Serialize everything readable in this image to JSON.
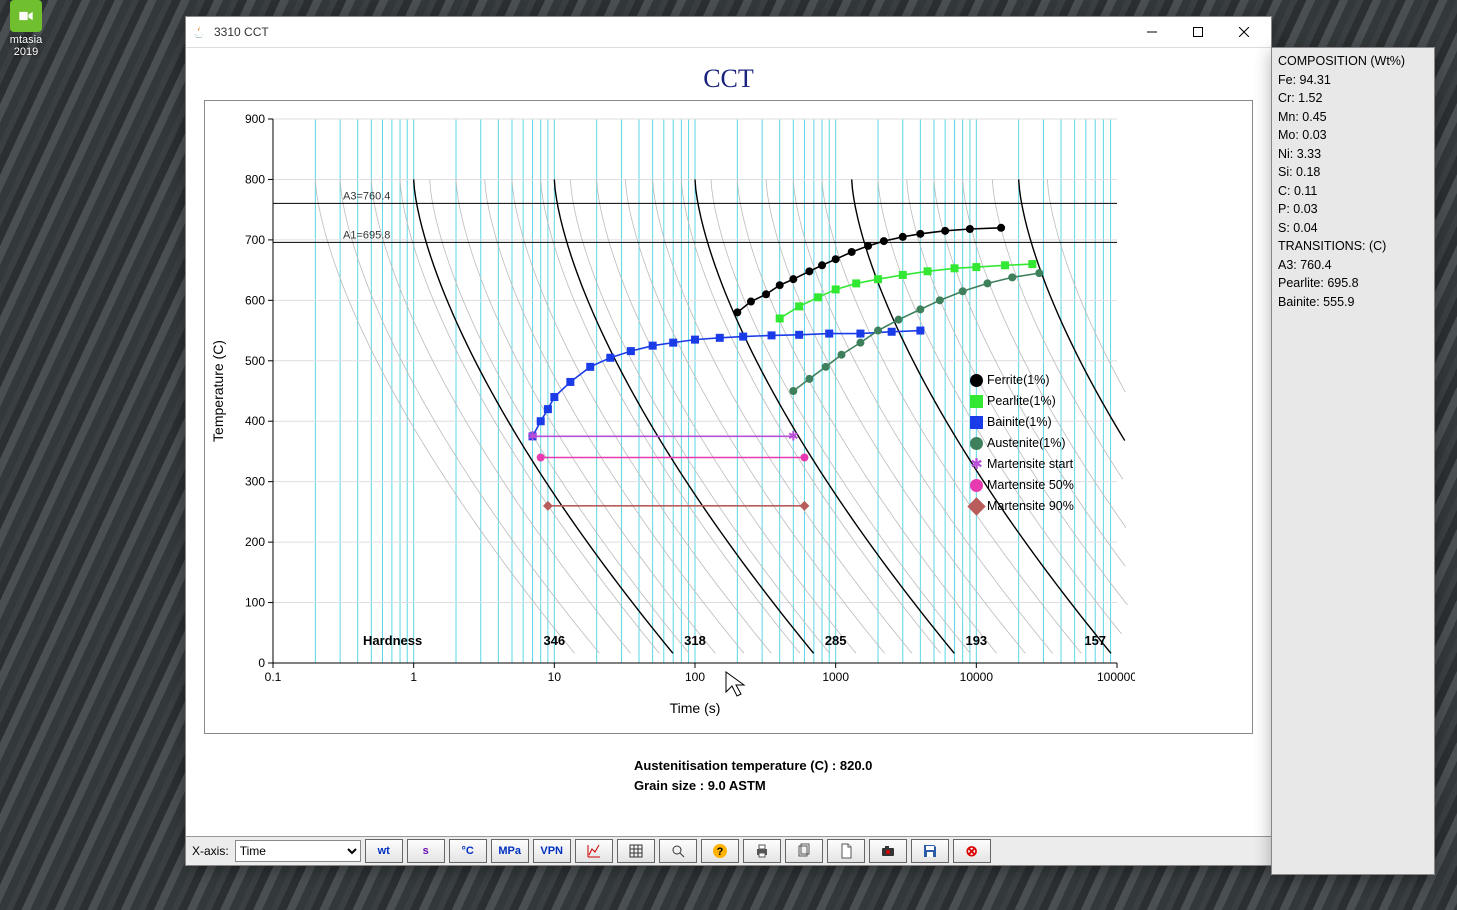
{
  "desktop_icon": {
    "label": "mtasia",
    "label2": "2019"
  },
  "window": {
    "title": "3310 CCT",
    "chart_title": "CCT",
    "caption_line1": "Austenitisation temperature (C) : 820.0",
    "caption_line2": "Grain size : 9.0 ASTM"
  },
  "statusbar": {
    "xaxis_label": "X-axis:",
    "xaxis_value": "Time",
    "buttons": [
      "wt",
      "s",
      "°C",
      "MPa",
      "VPN"
    ]
  },
  "legend": [
    {
      "label": "Ferrite(1%)",
      "color": "#000000",
      "shape": "circle"
    },
    {
      "label": "Pearlite(1%)",
      "color": "#33e833",
      "shape": "square"
    },
    {
      "label": "Bainite(1%)",
      "color": "#1a3be8",
      "shape": "square"
    },
    {
      "label": "Austenite(1%)",
      "color": "#3e7f5c",
      "shape": "circle"
    },
    {
      "label": "Martensite start",
      "color": "#b84fd9",
      "shape": "star"
    },
    {
      "label": "Martensite 50%",
      "color": "#e83ab0",
      "shape": "circle"
    },
    {
      "label": "Martensite 90%",
      "color": "#b85c5c",
      "shape": "diamond"
    }
  ],
  "sidebar": {
    "header": "COMPOSITION (Wt%)",
    "rows": [
      "Fe: 94.31",
      "Cr: 1.52",
      "Mn: 0.45",
      "Mo: 0.03",
      "Ni: 3.33",
      "Si: 0.18",
      "C: 0.11",
      "P: 0.03",
      "S: 0.04"
    ],
    "trans_header": "TRANSITIONS: (C)",
    "trans_rows": [
      "A3: 760.4",
      "Pearlite: 695.8",
      "Bainite: 555.9"
    ]
  },
  "chart_data": {
    "type": "line",
    "title": "CCT",
    "xlabel": "Time (s)",
    "ylabel": "Temperature (C)",
    "xscale": "log",
    "xlim": [
      0.1,
      100000
    ],
    "ylim": [
      0,
      900
    ],
    "hlines": [
      {
        "y": 760.4,
        "label": "A3=760.4"
      },
      {
        "y": 695.8,
        "label": "A1=695.8"
      }
    ],
    "hardness_row": {
      "label": "Hardness",
      "values": [
        346,
        318,
        285,
        193,
        157
      ]
    },
    "series": [
      {
        "name": "Ferrite(1%)",
        "color": "#000000",
        "marker": "o",
        "data": [
          [
            200,
            580
          ],
          [
            250,
            598
          ],
          [
            320,
            610
          ],
          [
            400,
            625
          ],
          [
            500,
            635
          ],
          [
            650,
            648
          ],
          [
            800,
            658
          ],
          [
            1000,
            668
          ],
          [
            1300,
            680
          ],
          [
            1700,
            690
          ],
          [
            2200,
            698
          ],
          [
            3000,
            705
          ],
          [
            4000,
            710
          ],
          [
            6000,
            715
          ],
          [
            9000,
            718
          ],
          [
            15000,
            720
          ]
        ]
      },
      {
        "name": "Pearlite(1%)",
        "color": "#33e833",
        "marker": "s",
        "data": [
          [
            400,
            570
          ],
          [
            550,
            590
          ],
          [
            750,
            605
          ],
          [
            1000,
            618
          ],
          [
            1400,
            628
          ],
          [
            2000,
            635
          ],
          [
            3000,
            642
          ],
          [
            4500,
            648
          ],
          [
            7000,
            653
          ],
          [
            10000,
            655
          ],
          [
            16000,
            658
          ],
          [
            25000,
            660
          ]
        ]
      },
      {
        "name": "Bainite(1%)",
        "color": "#1a3be8",
        "marker": "s",
        "data": [
          [
            7,
            375
          ],
          [
            8,
            400
          ],
          [
            9,
            420
          ],
          [
            10,
            440
          ],
          [
            13,
            465
          ],
          [
            18,
            490
          ],
          [
            25,
            505
          ],
          [
            35,
            516
          ],
          [
            50,
            525
          ],
          [
            70,
            530
          ],
          [
            100,
            535
          ],
          [
            150,
            538
          ],
          [
            220,
            540
          ],
          [
            350,
            542
          ],
          [
            550,
            543
          ],
          [
            900,
            545
          ],
          [
            1500,
            545
          ],
          [
            2500,
            548
          ],
          [
            4000,
            550
          ]
        ]
      },
      {
        "name": "Austenite(1%)",
        "color": "#3e7f5c",
        "marker": "o",
        "data": [
          [
            500,
            450
          ],
          [
            650,
            470
          ],
          [
            850,
            490
          ],
          [
            1100,
            510
          ],
          [
            1500,
            530
          ],
          [
            2000,
            550
          ],
          [
            2800,
            568
          ],
          [
            4000,
            585
          ],
          [
            5500,
            600
          ],
          [
            8000,
            615
          ],
          [
            12000,
            628
          ],
          [
            18000,
            638
          ],
          [
            28000,
            645
          ]
        ]
      },
      {
        "name": "Martensite start",
        "color": "#b84fd9",
        "marker": "*",
        "data": [
          [
            7,
            375
          ],
          [
            500,
            375
          ]
        ]
      },
      {
        "name": "Martensite 50%",
        "color": "#e83ab0",
        "marker": "o",
        "data": [
          [
            8,
            340
          ],
          [
            600,
            340
          ]
        ]
      },
      {
        "name": "Martensite 90%",
        "color": "#b85c5c",
        "marker": "d",
        "data": [
          [
            9,
            260
          ],
          [
            600,
            260
          ]
        ]
      }
    ],
    "cooling_curve_starts": [
      0.2,
      0.3,
      0.5,
      0.8,
      1.3,
      2,
      3.2,
      5,
      8,
      13,
      20,
      32,
      50,
      80,
      130,
      200,
      320,
      500,
      800,
      1300,
      2000,
      3200,
      5000,
      8000,
      13000,
      20000,
      32000
    ]
  }
}
